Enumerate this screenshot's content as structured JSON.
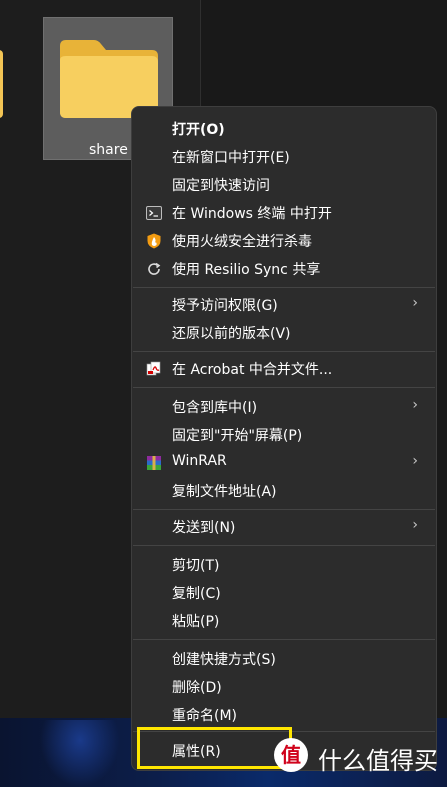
{
  "explorer": {
    "folder_label": "share"
  },
  "menu": {
    "items": [
      {
        "label": "打开(O)"
      },
      {
        "label": "在新窗口中打开(E)"
      },
      {
        "label": "固定到快速访问"
      },
      {
        "label": "在 Windows 终端 中打开",
        "icon": "terminal-icon"
      },
      {
        "label": "使用火绒安全进行杀毒",
        "icon": "huorong-shield-icon"
      },
      {
        "label": "使用 Resilio Sync 共享",
        "icon": "sync-icon"
      },
      {
        "label": "授予访问权限(G)",
        "submenu": true
      },
      {
        "label": "还原以前的版本(V)"
      },
      {
        "label": "在 Acrobat 中合并文件...",
        "icon": "acrobat-icon"
      },
      {
        "label": "包含到库中(I)",
        "submenu": true
      },
      {
        "label": "固定到\"开始\"屏幕(P)"
      },
      {
        "label": "WinRAR",
        "icon": "winrar-icon",
        "submenu": true
      },
      {
        "label": "复制文件地址(A)"
      },
      {
        "label": "发送到(N)",
        "submenu": true
      },
      {
        "label": "剪切(T)"
      },
      {
        "label": "复制(C)"
      },
      {
        "label": "粘贴(P)"
      },
      {
        "label": "创建快捷方式(S)"
      },
      {
        "label": "删除(D)"
      },
      {
        "label": "重命名(M)"
      },
      {
        "label": "属性(R)"
      }
    ],
    "chevron": "›"
  },
  "watermark": {
    "logo_text": "值",
    "text": "什么值得买"
  },
  "colors": {
    "highlight": "#ffe600",
    "menu_bg": "#2c2c2c"
  }
}
